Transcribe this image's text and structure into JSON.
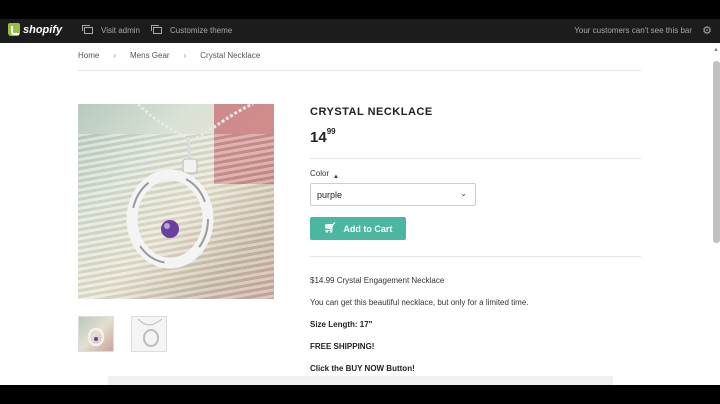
{
  "adminbar": {
    "logo_text": "shopify",
    "visit_admin": "Visit admin",
    "customize_theme": "Customize theme",
    "notice": "Your customers can't see this bar",
    "settings_icon": "gear-icon"
  },
  "breadcrumb": {
    "items": [
      "Home",
      "Mens Gear",
      "Crystal Necklace"
    ],
    "separator": "›"
  },
  "product": {
    "title": "CRYSTAL NECKLACE",
    "price_whole": "14",
    "price_cents": "99",
    "color_label": "Color",
    "color_value": "purple",
    "add_to_cart": "Add to Cart",
    "description": [
      "$14.99 Crystal Engagement Necklace",
      "You can get this beautiful necklace, but only for a limited time.",
      "Size Length: 17\"",
      "FREE SHIPPING!",
      "Click the BUY NOW Button!"
    ]
  },
  "colors": {
    "accent": "#4cb7a0",
    "adminbar": "#1c1c1c",
    "shopify_green": "#95bf47"
  }
}
